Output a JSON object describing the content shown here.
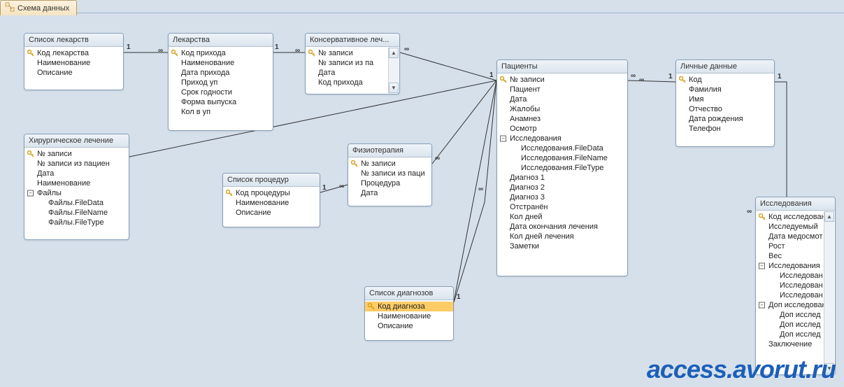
{
  "tab_title": "Схема данных",
  "watermark": "access.avorut.ru",
  "rel_one": "1",
  "rel_many": "∞",
  "tables": {
    "medlist": {
      "title": "Список лекарств",
      "fields": [
        "Код лекарства",
        "Наименование",
        "Описание"
      ],
      "keys": [
        0
      ]
    },
    "meds": {
      "title": "Лекарства",
      "fields": [
        "Код прихода",
        "Наименование",
        "Дата прихода",
        "Приход уп",
        "Срок годности",
        "Форма выпуска",
        "Кол в уп"
      ],
      "keys": [
        0
      ]
    },
    "conserv": {
      "title": "Консервативное леч...",
      "fields": [
        "№ записи",
        "№ записи из па",
        "Дата",
        "Код прихода"
      ],
      "keys": [
        0
      ]
    },
    "surg": {
      "title": "Хирургическое лечение",
      "fields": [
        "№ записи",
        "№ записи из пациен",
        "Дата",
        "Наименование",
        "Файлы",
        "Файлы.FileData",
        "Файлы.FileName",
        "Файлы.FileType"
      ],
      "keys": [
        0
      ],
      "expand": [
        4
      ],
      "indent": [
        5,
        6,
        7
      ]
    },
    "proclist": {
      "title": "Список процедур",
      "fields": [
        "Код процедуры",
        "Наименование",
        "Описание"
      ],
      "keys": [
        0
      ]
    },
    "physio": {
      "title": "Физиотерапия",
      "fields": [
        "№ записи",
        "№ записи из паци",
        "Процедура",
        "Дата"
      ],
      "keys": [
        0
      ]
    },
    "diaglist": {
      "title": "Список диагнозов",
      "fields": [
        "Код диагноза",
        "Наименование",
        "Описание"
      ],
      "keys": [
        0
      ],
      "selected": [
        0
      ]
    },
    "patients": {
      "title": "Пациенты",
      "fields": [
        "№ записи",
        "Пациент",
        "Дата",
        "Жалобы",
        "Анамнез",
        "Осмотр",
        "Исследования",
        "Исследования.FileData",
        "Исследования.FileName",
        "Исследования.FileType",
        "Диагноз 1",
        "Диагноз 2",
        "Диагноз 3",
        "Отстранён",
        "Кол дней",
        "Дата окончания лечения",
        "Кол дней лечения",
        "Заметки"
      ],
      "keys": [
        0
      ],
      "expand": [
        6
      ],
      "indent": [
        7,
        8,
        9
      ]
    },
    "personal": {
      "title": "Личные данные",
      "fields": [
        "Код",
        "Фамилия",
        "Имя",
        "Отчество",
        "Дата рождения",
        "Телефон"
      ],
      "keys": [
        0
      ]
    },
    "research": {
      "title": "Исследования",
      "fields": [
        "Код исследован",
        "Исследуемый",
        "Дата медосмот",
        "Рост",
        "Вес",
        "Исследования",
        "Исследован",
        "Исследован",
        "Исследован",
        "Доп исследован",
        "Доп исслед",
        "Доп исслед",
        "Доп исслед",
        "Заключение"
      ],
      "keys": [
        0
      ],
      "expand": [
        5,
        9
      ],
      "indent": [
        6,
        7,
        8,
        10,
        11,
        12
      ]
    }
  }
}
